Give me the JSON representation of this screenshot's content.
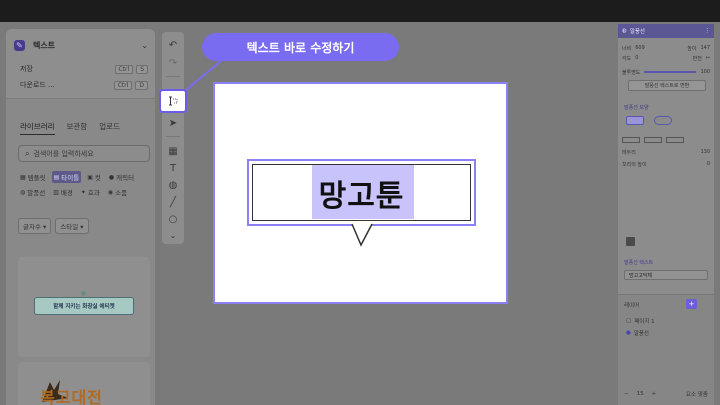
{
  "left_panel": {
    "title": "텍스트",
    "menu": [
      {
        "label": "저장",
        "keys": [
          "Ctrl",
          "S"
        ]
      },
      {
        "label": "다운로드 ...",
        "keys": [
          "Ctrl",
          "D"
        ]
      }
    ],
    "tabs": [
      "라이브러리",
      "보관함",
      "업로드"
    ],
    "search_placeholder": "검색어를 입력하세요",
    "chips": [
      "템플릿",
      "타이틀",
      "컷",
      "캐릭터",
      "말풍선",
      "배경",
      "효과",
      "소품"
    ],
    "filters": [
      "글자수 ▾",
      "스타일 ▾"
    ],
    "thumb1_text": "함께 지키는 화장실 에티켓",
    "thumb2_text": "복고대전"
  },
  "toolbar": {
    "icons": [
      "undo-icon",
      "redo-icon",
      "text-edit-icon",
      "select-icon",
      "layers-icon",
      "text-tool-icon",
      "bubble-tool-icon",
      "line-tool-icon",
      "circle-tool-icon",
      "more-icon"
    ]
  },
  "tooltip": {
    "label": "텍스트 바로 수정하기"
  },
  "canvas": {
    "bubble_text": "망고툰"
  },
  "right_panel": {
    "header": "말풍선",
    "line1": [
      "너비",
      "609",
      "높이",
      "147"
    ],
    "line2": [
      "각도",
      "0",
      "반전",
      "↔"
    ],
    "line3": [
      "불투명도",
      "100"
    ],
    "convert_button": "말풍선 텍스트로 변환",
    "section_shape": "말풍선 모양",
    "section_stroke": "테두리",
    "stroke_width": "130",
    "tail_label": "꼬리의 높이",
    "tail_value": "0",
    "section_font": "말풍선 텍스트",
    "font_name": "망고고딕체",
    "layers_title": "레이어",
    "layers": [
      "페이지 1",
      "말풍선"
    ],
    "zoom_value": "15",
    "fit_label": "요소 맞춤"
  }
}
